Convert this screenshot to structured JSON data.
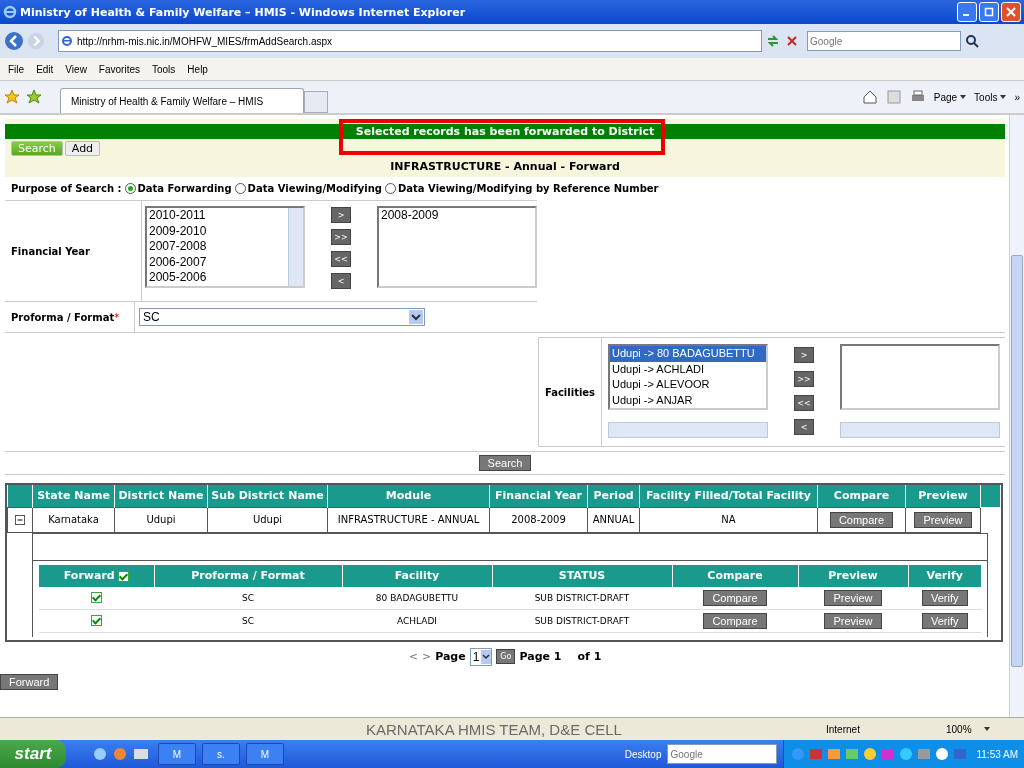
{
  "window": {
    "title": "Ministry of Health & Family Welfare – HMIS - Windows Internet Explorer"
  },
  "address_bar": {
    "url": "http://nrhm-mis.nic.in/MOHFW_MIES/frmAddSearch.aspx"
  },
  "search_box": {
    "placeholder": "Google"
  },
  "menu": [
    "File",
    "Edit",
    "View",
    "Favorites",
    "Tools",
    "Help"
  ],
  "tabs": [
    {
      "label": "Ministry of Health & Family Welfare – HMIS",
      "selected": true
    }
  ],
  "command_bar": {
    "page": "Page",
    "tools": "Tools",
    "more": "»"
  },
  "page": {
    "message": "Selected records has been forwarded to District",
    "buttons": [
      {
        "label": "Search",
        "selected": true
      },
      {
        "label": "Add",
        "selected": false
      }
    ],
    "heading": "INFRASTRUCTURE - Annual - Forward",
    "purpose": {
      "label": "Purpose of Search :",
      "options": [
        {
          "label": "Data Forwarding",
          "selected": true
        },
        {
          "label": "Data Viewing/Modifying",
          "selected": false
        },
        {
          "label": "Data Viewing/Modifying by Reference Number",
          "selected": false
        }
      ]
    },
    "financial_year": {
      "label": "Financial Year",
      "available": [
        "2010-2011",
        "2009-2010",
        "2007-2008",
        "2006-2007",
        "2005-2006"
      ],
      "chosen": [
        "2008-2009"
      ],
      "move_buttons": [
        ">",
        ">>",
        "<<",
        "<"
      ]
    },
    "proforma": {
      "label": "Proforma / Format",
      "required_mark": "*",
      "value": "SC"
    },
    "facilities": {
      "label": "Facilities",
      "available": [
        {
          "label": "Udupi -> 80 BADAGUBETTU",
          "selected": true
        },
        {
          "label": "Udupi -> ACHLADI",
          "selected": false
        },
        {
          "label": "Udupi -> ALEVOOR",
          "selected": false
        },
        {
          "label": "Udupi -> ANJAR",
          "selected": false
        }
      ],
      "move_buttons": [
        ">",
        ">>",
        "<<",
        "<"
      ]
    },
    "search_button": "Search",
    "table": {
      "columns": [
        "State Name",
        "District Name",
        "Sub District Name",
        "Module",
        "Financial Year",
        "Period",
        "Facility Filled/Total Facility",
        "Compare",
        "Preview"
      ],
      "rows": [
        {
          "expanded": true,
          "cells": [
            "Karnataka",
            "Udupi",
            "Udupi",
            "INFRASTRUCTURE - ANNUAL",
            "2008-2009",
            "ANNUAL",
            "NA"
          ],
          "buttons": [
            "Compare",
            "Preview"
          ]
        }
      ]
    },
    "sub_table": {
      "columns": [
        {
          "label": "Forward",
          "checked": true
        },
        {
          "label": "Proforma / Format"
        },
        {
          "label": "Facility"
        },
        {
          "label": "STATUS"
        },
        {
          "label": "Compare"
        },
        {
          "label": "Preview"
        },
        {
          "label": "Verify"
        }
      ],
      "rows": [
        {
          "forward": true,
          "proforma_format": "SC",
          "facility": "80 BADAGUBETTU",
          "status": "SUB DISTRICT-DRAFT",
          "compare": "Compare",
          "preview": "Preview",
          "verify": "Verify"
        },
        {
          "forward": true,
          "proforma_format": "SC",
          "facility": "ACHLADI",
          "status": "SUB DISTRICT-DRAFT",
          "compare": "Compare",
          "preview": "Preview",
          "verify": "Verify"
        }
      ]
    },
    "pager": {
      "prev": "<",
      "next": ">",
      "label": "Page",
      "value": "1",
      "go": "Go",
      "current": "Page 1",
      "total": "of 1"
    },
    "forward_button": "Forward"
  },
  "status_bar": {
    "caption": "KARNATAKA HMIS TEAM, D&E CELL",
    "zone": "Internet",
    "zoom": "100%"
  },
  "taskbar": {
    "start": "start",
    "tasks": [
      "M",
      "s.",
      "M"
    ],
    "desktop": "Desktop",
    "search_placeholder": "Google",
    "clock": "11:53 AM"
  }
}
